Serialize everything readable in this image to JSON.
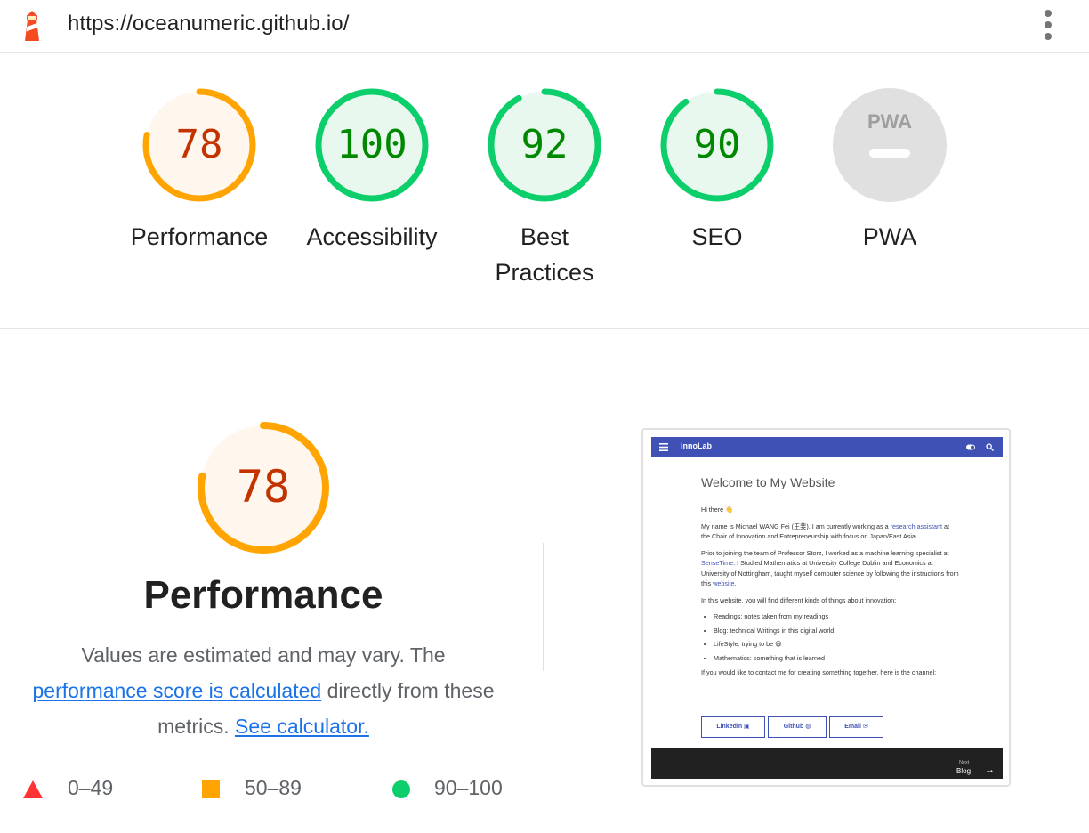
{
  "header": {
    "url": "https://oceanumeric.github.io/",
    "logo_icon": "lighthouse-icon",
    "menu_icon": "more-vert-icon"
  },
  "gauges": [
    {
      "label": "Performance",
      "score": "78",
      "fraction": 0.78,
      "color": "#ffa400",
      "text_color": "#c33300",
      "fill": "#fff7ed"
    },
    {
      "label": "Accessibility",
      "score": "100",
      "fraction": 1.0,
      "color": "#0cce6b",
      "text_color": "#008800",
      "fill": "#e8f8ef"
    },
    {
      "label": "Best Practices",
      "score": "92",
      "fraction": 0.92,
      "color": "#0cce6b",
      "text_color": "#008800",
      "fill": "#e8f8ef"
    },
    {
      "label": "SEO",
      "score": "90",
      "fraction": 0.9,
      "color": "#0cce6b",
      "text_color": "#008800",
      "fill": "#e8f8ef"
    },
    {
      "label": "PWA",
      "badge": "PWA",
      "color": "#e0e0e0",
      "text_color": "#9e9e9e"
    }
  ],
  "performance": {
    "score": "78",
    "fraction": 0.78,
    "title": "Performance",
    "desc_1": "Values are estimated and may vary. The",
    "link_1": "performance score is calculated",
    "desc_2": " directly from these metrics. ",
    "link_2": "See calculator."
  },
  "legend": [
    {
      "range": "0–49",
      "icon": "fail-triangle-icon",
      "color": "#ff3333"
    },
    {
      "range": "50–89",
      "icon": "average-square-icon",
      "color": "#ffa400"
    },
    {
      "range": "90–100",
      "icon": "pass-circle-icon",
      "color": "#0cce6b"
    }
  ],
  "screenshot": {
    "site_name": "innoLab",
    "heading": "Welcome to My Website",
    "greeting": "Hi there 👋",
    "p1_a": "My name is Michael WANG Fei (王斐). I am currently working as a ",
    "p1_link": "research assistant",
    "p1_b": " at the Chair of Innovation and Entrepreneurship with focus on Japan/East Asia.",
    "p2_a": "Prior to joining the team of Professor Storz, I worked as a machine learning specialist at ",
    "p2_link1": "SenseTime",
    "p2_b": ". I Studied Mathematics at University College Dublin and Economics at University of Nottingham, taught myself computer science by following the instructions from this ",
    "p2_link2": "website",
    "p2_c": ".",
    "p3": "In this website, you will find different kinds of things about innovation:",
    "items": [
      "Readings: notes taken from my readings",
      "Blog: technical Writings in this digital world",
      "LifeStyle: trying to be 😃",
      "Mathematics: something that is learned"
    ],
    "p4": "If you would like to contact me for creating something together, here is the channel:",
    "buttons": [
      "Linkedin",
      "Github",
      "Email"
    ],
    "footer_next": "Next",
    "footer_blog": "Blog",
    "footer_arrow": "→"
  }
}
